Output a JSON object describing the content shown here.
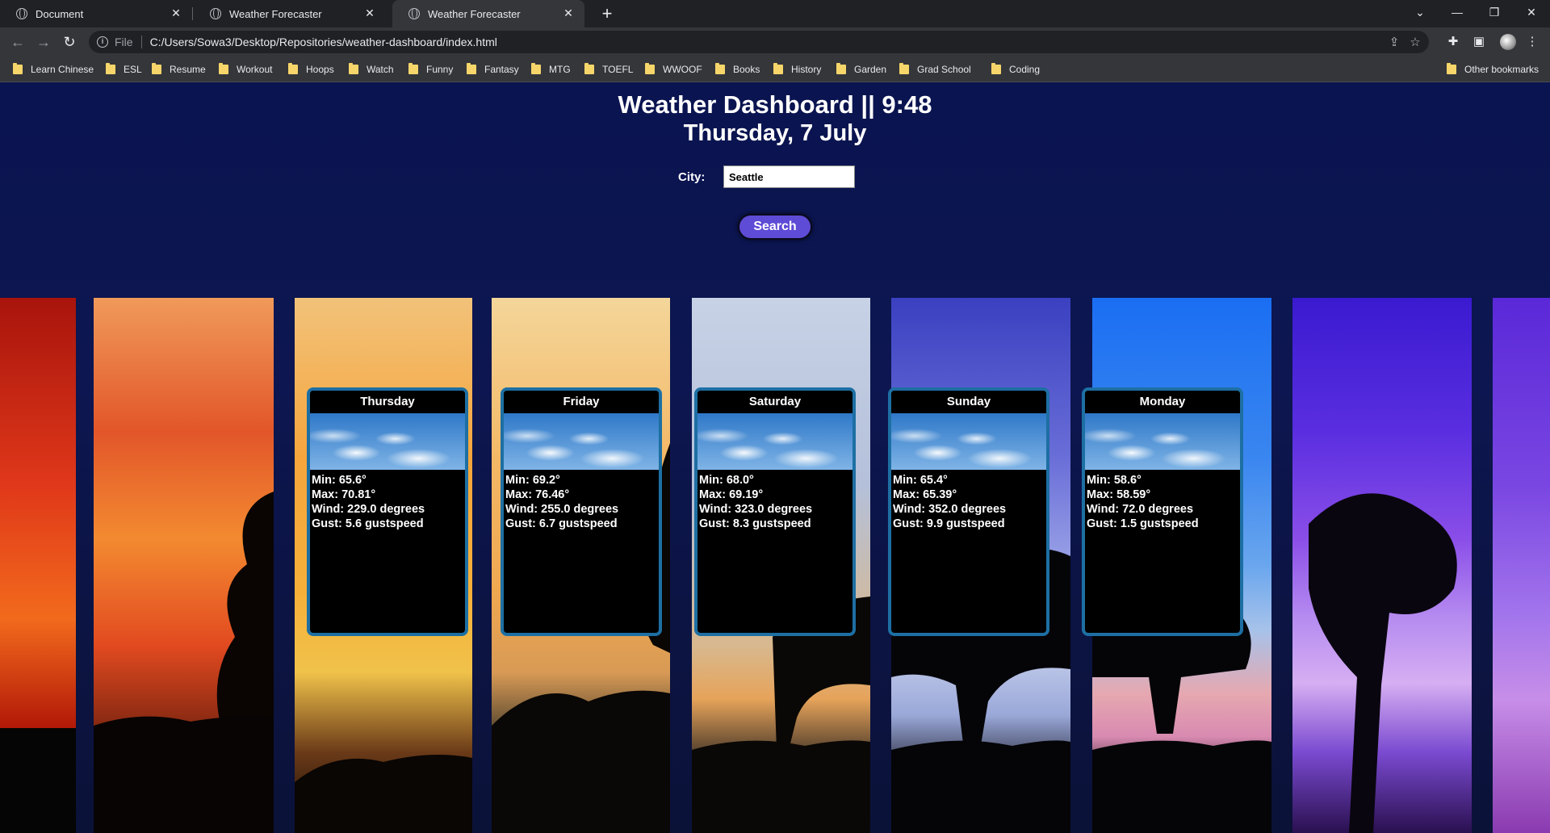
{
  "browser": {
    "tabs": [
      {
        "title": "Document",
        "active": false
      },
      {
        "title": "Weather Forecaster",
        "active": false
      },
      {
        "title": "Weather Forecaster",
        "active": true
      }
    ],
    "scheme_label": "File",
    "url": "C:/Users/Sowa3/Desktop/Repositories/weather-dashboard/index.html",
    "bookmarks": [
      "Learn Chinese",
      "ESL",
      "Resume",
      "Workout",
      "Hoops",
      "Watch",
      "Funny",
      "Fantasy",
      "MTG",
      "TOEFL",
      "WWOOF",
      "Books",
      "History",
      "Garden",
      "Grad School",
      "Coding"
    ],
    "other_bookmarks": "Other bookmarks"
  },
  "page": {
    "title": "Weather Dashboard || 9:48",
    "date": "Thursday, 7 July",
    "city_label": "City:",
    "city_value": "Seattle",
    "search_label": "Search"
  },
  "forecast": [
    {
      "day": "Thursday",
      "min": "Min: 65.6°",
      "max": "Max: 70.81°",
      "wind": "Wind: 229.0 degrees",
      "gust": "Gust: 5.6 gustspeed"
    },
    {
      "day": "Friday",
      "min": "Min: 69.2°",
      "max": "Max: 76.46°",
      "wind": "Wind: 255.0 degrees",
      "gust": "Gust: 6.7 gustspeed"
    },
    {
      "day": "Saturday",
      "min": "Min: 68.0°",
      "max": "Max: 69.19°",
      "wind": "Wind: 323.0 degrees",
      "gust": "Gust: 8.3 gustspeed"
    },
    {
      "day": "Sunday",
      "min": "Min: 65.4°",
      "max": "Max: 65.39°",
      "wind": "Wind: 352.0 degrees",
      "gust": "Gust: 9.9 gustspeed"
    },
    {
      "day": "Monday",
      "min": "Min: 58.6°",
      "max": "Max: 58.59°",
      "wind": "Wind: 72.0 degrees",
      "gust": "Gust: 1.5 gustspeed"
    }
  ],
  "colors": {
    "page_bg": "#0b1240",
    "card_border": "#1d6fa3",
    "search_button": "#5e4bd6",
    "folder_icon": "#f6d66a"
  }
}
